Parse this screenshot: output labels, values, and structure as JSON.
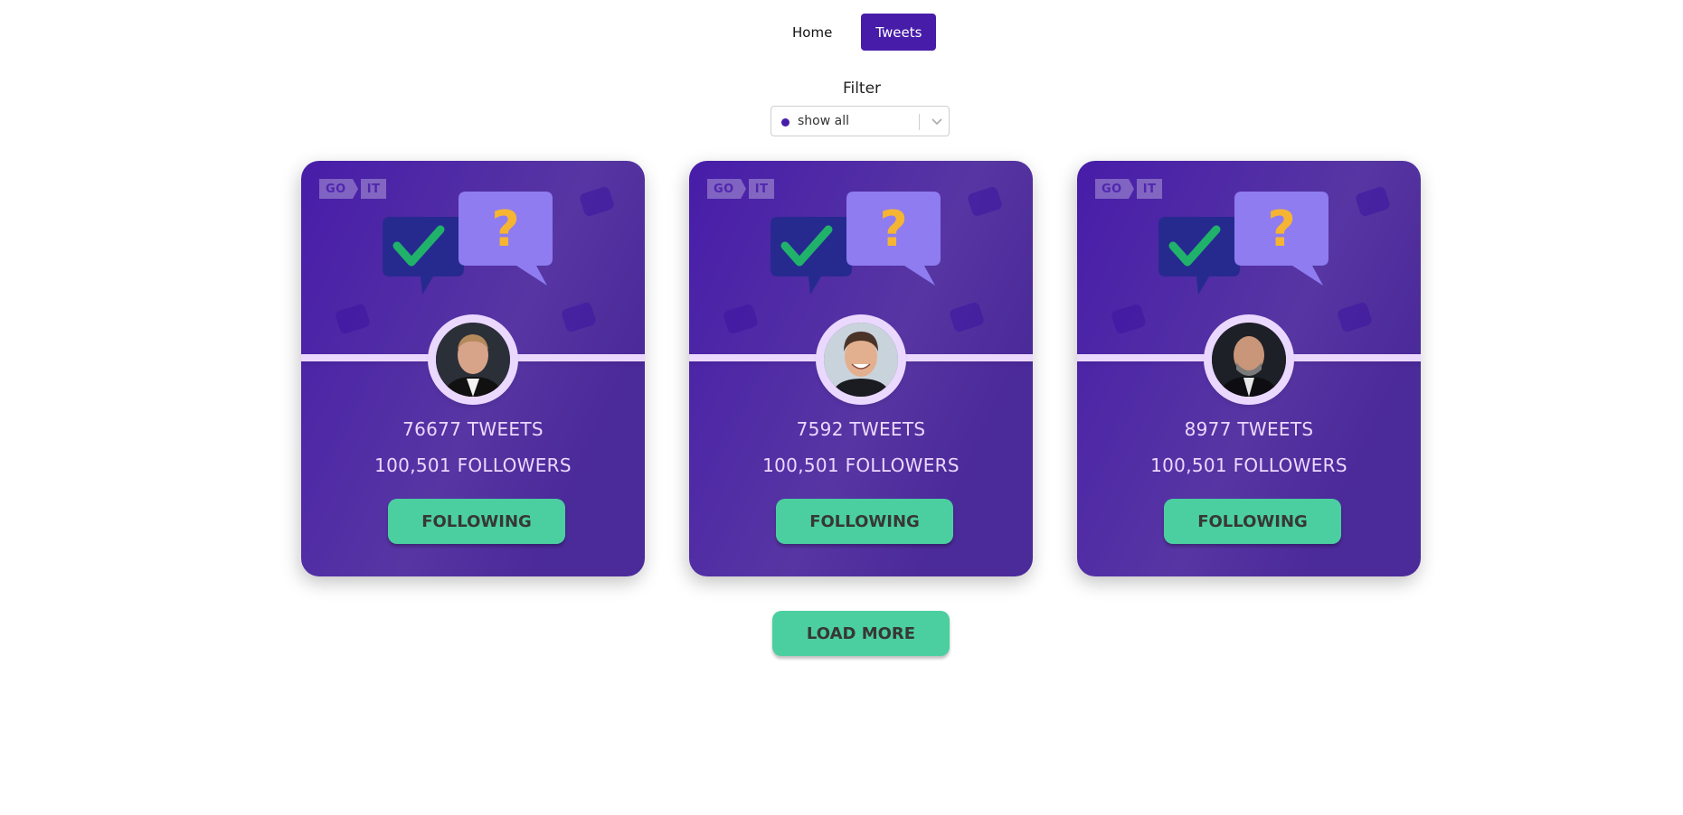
{
  "nav": {
    "home_label": "Home",
    "tweets_label": "Tweets"
  },
  "filter": {
    "label": "Filter",
    "selected": "show all",
    "dot_color": "#471ca9"
  },
  "cards": [
    {
      "tweets": "76677 TWEETS",
      "followers": "100,501 FOLLOWERS",
      "button": "FOLLOWING",
      "logo_a": "GO",
      "logo_b": "IT"
    },
    {
      "tweets": "7592 TWEETS",
      "followers": "100,501 FOLLOWERS",
      "button": "FOLLOWING",
      "logo_a": "GO",
      "logo_b": "IT"
    },
    {
      "tweets": "8977 TWEETS",
      "followers": "100,501 FOLLOWERS",
      "button": "FOLLOWING",
      "logo_a": "GO",
      "logo_b": "IT"
    }
  ],
  "load_more_label": "LOAD MORE",
  "colors": {
    "accent": "#471ca9",
    "button": "#4bcfa0",
    "card_text": "#ebd8ff"
  }
}
